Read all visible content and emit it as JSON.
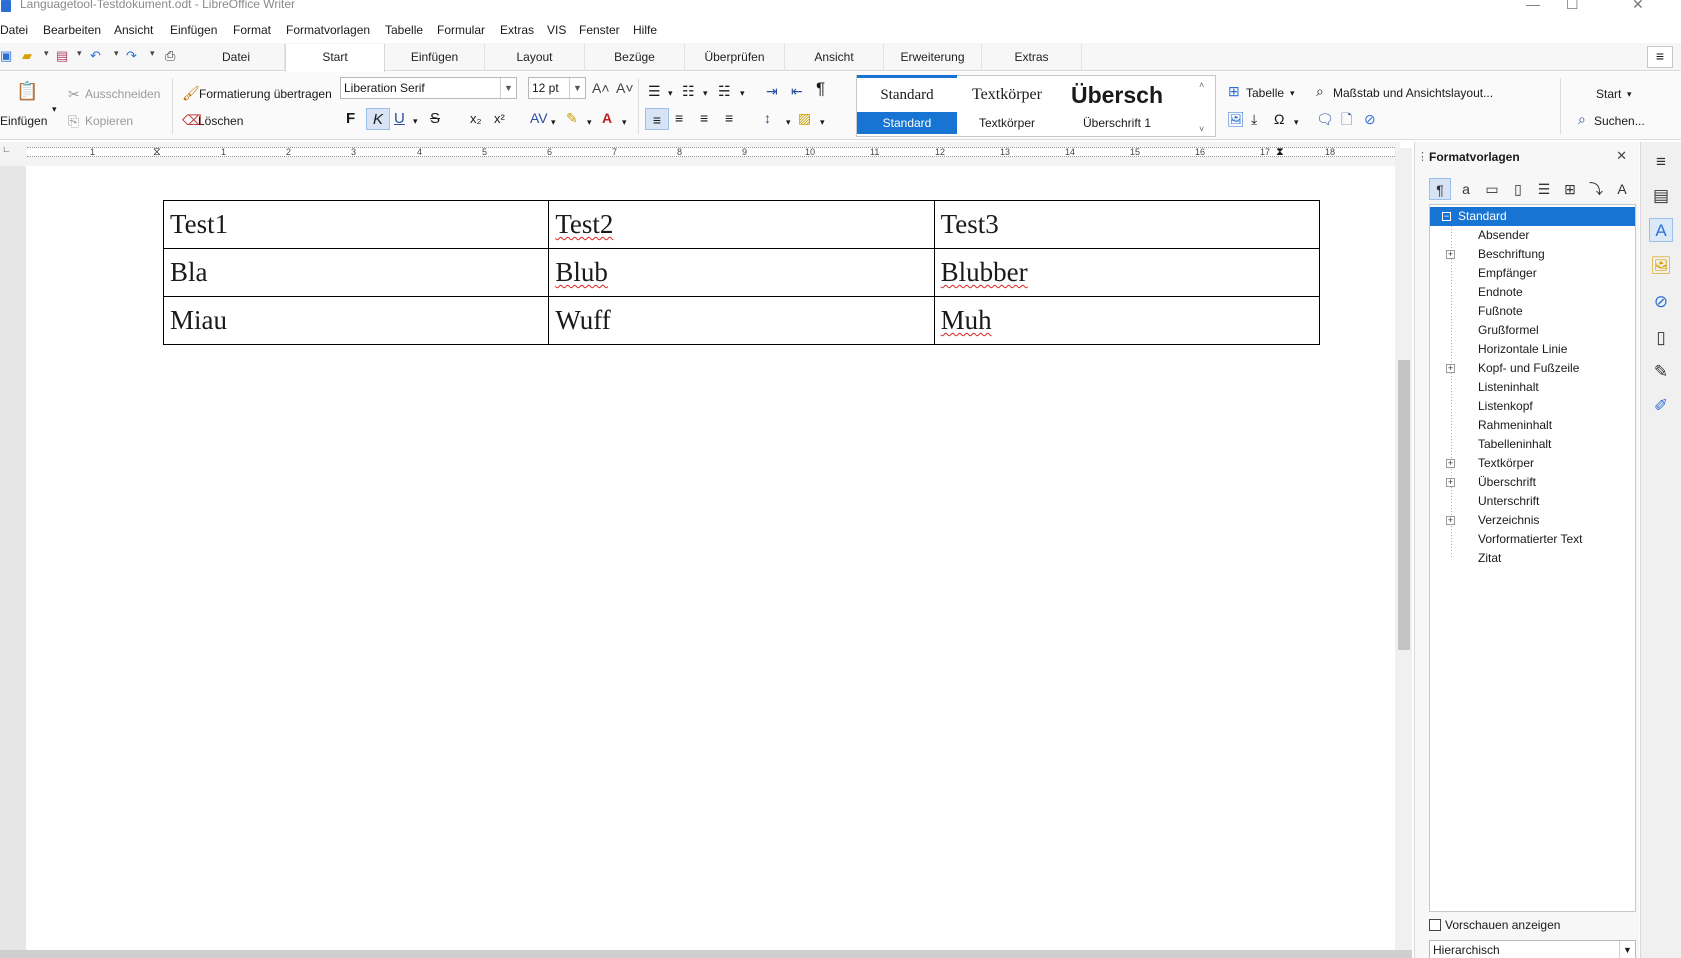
{
  "window": {
    "title": "Languagetool-Testdokument.odt - LibreOffice Writer",
    "minimize": "—",
    "maximize": "☐",
    "close": "✕"
  },
  "menu": [
    "Datei",
    "Bearbeiten",
    "Ansicht",
    "Einfügen",
    "Format",
    "Formatvorlagen",
    "Tabelle",
    "Formular",
    "Extras",
    "VIS",
    "Fenster",
    "Hilfe"
  ],
  "tabs": [
    "Datei",
    "Start",
    "Einfügen",
    "Layout",
    "Bezüge",
    "Überprüfen",
    "Ansicht",
    "Erweiterung",
    "Extras"
  ],
  "active_tab": "Start",
  "ribbon": {
    "paste_label": "Einfügen",
    "cut_label": "Ausschneiden",
    "copy_label": "Kopieren",
    "clone_format_label": "Formatierung übertragen",
    "clear_label": "Löschen",
    "font_name": "Liberation Serif",
    "font_size": "12 pt",
    "bold": "F",
    "italic": "K",
    "underline": "U",
    "strike": "S",
    "subscript": "x₂",
    "superscript": "x²",
    "table_label": "Tabelle",
    "zoom_label": "Maßstab und Ansichtslayout...",
    "start_label": "Start",
    "search_label": "Suchen..."
  },
  "style_previews": [
    {
      "big": "Standard",
      "label": "Standard"
    },
    {
      "big": "Textkörper",
      "label": "Textkörper"
    },
    {
      "big": "Übersch",
      "label": "Überschrift 1"
    }
  ],
  "ruler": [
    "1",
    "1",
    "2",
    "3",
    "4",
    "5",
    "6",
    "7",
    "8",
    "9",
    "10",
    "11",
    "12",
    "13",
    "14",
    "15",
    "16",
    "17",
    "18"
  ],
  "document": {
    "table": [
      [
        "Test1",
        "Test2",
        "Test3"
      ],
      [
        "Bla",
        "Blub",
        "Blubber"
      ],
      [
        "Miau",
        "Wuff",
        "Muh"
      ]
    ]
  },
  "sidebar": {
    "title": "Formatvorlagen",
    "selected": "Standard",
    "styles": [
      {
        "name": "Standard",
        "expandable": true,
        "selected": true
      },
      {
        "name": "Absender",
        "expandable": false
      },
      {
        "name": "Beschriftung",
        "expandable": true
      },
      {
        "name": "Empfänger",
        "expandable": false
      },
      {
        "name": "Endnote",
        "expandable": false
      },
      {
        "name": "Fußnote",
        "expandable": false
      },
      {
        "name": "Grußformel",
        "expandable": false
      },
      {
        "name": "Horizontale Linie",
        "expandable": false
      },
      {
        "name": "Kopf- und Fußzeile",
        "expandable": true
      },
      {
        "name": "Listeninhalt",
        "expandable": false
      },
      {
        "name": "Listenkopf",
        "expandable": false
      },
      {
        "name": "Rahmeninhalt",
        "expandable": false
      },
      {
        "name": "Tabelleninhalt",
        "expandable": false
      },
      {
        "name": "Textkörper",
        "expandable": true
      },
      {
        "name": "Überschrift",
        "expandable": true
      },
      {
        "name": "Unterschrift",
        "expandable": false
      },
      {
        "name": "Verzeichnis",
        "expandable": true
      },
      {
        "name": "Vorformatierter Text",
        "expandable": false
      },
      {
        "name": "Zitat",
        "expandable": false
      }
    ],
    "preview_label": "Vorschauen anzeigen",
    "filter_value": "Hierarchisch"
  },
  "colors": {
    "accent": "#1874d2",
    "spellcheck": "#dd2222"
  }
}
